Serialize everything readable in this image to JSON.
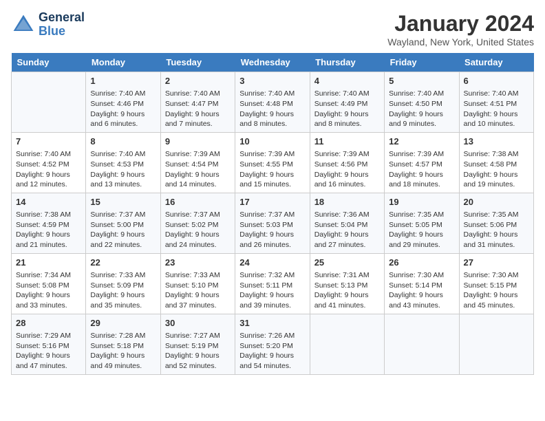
{
  "header": {
    "logo_line1": "General",
    "logo_line2": "Blue",
    "month": "January 2024",
    "location": "Wayland, New York, United States"
  },
  "days": [
    "Sunday",
    "Monday",
    "Tuesday",
    "Wednesday",
    "Thursday",
    "Friday",
    "Saturday"
  ],
  "weeks": [
    [
      {
        "date": "",
        "sunrise": "",
        "sunset": "",
        "daylight": ""
      },
      {
        "date": "1",
        "sunrise": "Sunrise: 7:40 AM",
        "sunset": "Sunset: 4:46 PM",
        "daylight": "Daylight: 9 hours and 6 minutes."
      },
      {
        "date": "2",
        "sunrise": "Sunrise: 7:40 AM",
        "sunset": "Sunset: 4:47 PM",
        "daylight": "Daylight: 9 hours and 7 minutes."
      },
      {
        "date": "3",
        "sunrise": "Sunrise: 7:40 AM",
        "sunset": "Sunset: 4:48 PM",
        "daylight": "Daylight: 9 hours and 8 minutes."
      },
      {
        "date": "4",
        "sunrise": "Sunrise: 7:40 AM",
        "sunset": "Sunset: 4:49 PM",
        "daylight": "Daylight: 9 hours and 8 minutes."
      },
      {
        "date": "5",
        "sunrise": "Sunrise: 7:40 AM",
        "sunset": "Sunset: 4:50 PM",
        "daylight": "Daylight: 9 hours and 9 minutes."
      },
      {
        "date": "6",
        "sunrise": "Sunrise: 7:40 AM",
        "sunset": "Sunset: 4:51 PM",
        "daylight": "Daylight: 9 hours and 10 minutes."
      }
    ],
    [
      {
        "date": "7",
        "sunrise": "Sunrise: 7:40 AM",
        "sunset": "Sunset: 4:52 PM",
        "daylight": "Daylight: 9 hours and 12 minutes."
      },
      {
        "date": "8",
        "sunrise": "Sunrise: 7:40 AM",
        "sunset": "Sunset: 4:53 PM",
        "daylight": "Daylight: 9 hours and 13 minutes."
      },
      {
        "date": "9",
        "sunrise": "Sunrise: 7:39 AM",
        "sunset": "Sunset: 4:54 PM",
        "daylight": "Daylight: 9 hours and 14 minutes."
      },
      {
        "date": "10",
        "sunrise": "Sunrise: 7:39 AM",
        "sunset": "Sunset: 4:55 PM",
        "daylight": "Daylight: 9 hours and 15 minutes."
      },
      {
        "date": "11",
        "sunrise": "Sunrise: 7:39 AM",
        "sunset": "Sunset: 4:56 PM",
        "daylight": "Daylight: 9 hours and 16 minutes."
      },
      {
        "date": "12",
        "sunrise": "Sunrise: 7:39 AM",
        "sunset": "Sunset: 4:57 PM",
        "daylight": "Daylight: 9 hours and 18 minutes."
      },
      {
        "date": "13",
        "sunrise": "Sunrise: 7:38 AM",
        "sunset": "Sunset: 4:58 PM",
        "daylight": "Daylight: 9 hours and 19 minutes."
      }
    ],
    [
      {
        "date": "14",
        "sunrise": "Sunrise: 7:38 AM",
        "sunset": "Sunset: 4:59 PM",
        "daylight": "Daylight: 9 hours and 21 minutes."
      },
      {
        "date": "15",
        "sunrise": "Sunrise: 7:37 AM",
        "sunset": "Sunset: 5:00 PM",
        "daylight": "Daylight: 9 hours and 22 minutes."
      },
      {
        "date": "16",
        "sunrise": "Sunrise: 7:37 AM",
        "sunset": "Sunset: 5:02 PM",
        "daylight": "Daylight: 9 hours and 24 minutes."
      },
      {
        "date": "17",
        "sunrise": "Sunrise: 7:37 AM",
        "sunset": "Sunset: 5:03 PM",
        "daylight": "Daylight: 9 hours and 26 minutes."
      },
      {
        "date": "18",
        "sunrise": "Sunrise: 7:36 AM",
        "sunset": "Sunset: 5:04 PM",
        "daylight": "Daylight: 9 hours and 27 minutes."
      },
      {
        "date": "19",
        "sunrise": "Sunrise: 7:35 AM",
        "sunset": "Sunset: 5:05 PM",
        "daylight": "Daylight: 9 hours and 29 minutes."
      },
      {
        "date": "20",
        "sunrise": "Sunrise: 7:35 AM",
        "sunset": "Sunset: 5:06 PM",
        "daylight": "Daylight: 9 hours and 31 minutes."
      }
    ],
    [
      {
        "date": "21",
        "sunrise": "Sunrise: 7:34 AM",
        "sunset": "Sunset: 5:08 PM",
        "daylight": "Daylight: 9 hours and 33 minutes."
      },
      {
        "date": "22",
        "sunrise": "Sunrise: 7:33 AM",
        "sunset": "Sunset: 5:09 PM",
        "daylight": "Daylight: 9 hours and 35 minutes."
      },
      {
        "date": "23",
        "sunrise": "Sunrise: 7:33 AM",
        "sunset": "Sunset: 5:10 PM",
        "daylight": "Daylight: 9 hours and 37 minutes."
      },
      {
        "date": "24",
        "sunrise": "Sunrise: 7:32 AM",
        "sunset": "Sunset: 5:11 PM",
        "daylight": "Daylight: 9 hours and 39 minutes."
      },
      {
        "date": "25",
        "sunrise": "Sunrise: 7:31 AM",
        "sunset": "Sunset: 5:13 PM",
        "daylight": "Daylight: 9 hours and 41 minutes."
      },
      {
        "date": "26",
        "sunrise": "Sunrise: 7:30 AM",
        "sunset": "Sunset: 5:14 PM",
        "daylight": "Daylight: 9 hours and 43 minutes."
      },
      {
        "date": "27",
        "sunrise": "Sunrise: 7:30 AM",
        "sunset": "Sunset: 5:15 PM",
        "daylight": "Daylight: 9 hours and 45 minutes."
      }
    ],
    [
      {
        "date": "28",
        "sunrise": "Sunrise: 7:29 AM",
        "sunset": "Sunset: 5:16 PM",
        "daylight": "Daylight: 9 hours and 47 minutes."
      },
      {
        "date": "29",
        "sunrise": "Sunrise: 7:28 AM",
        "sunset": "Sunset: 5:18 PM",
        "daylight": "Daylight: 9 hours and 49 minutes."
      },
      {
        "date": "30",
        "sunrise": "Sunrise: 7:27 AM",
        "sunset": "Sunset: 5:19 PM",
        "daylight": "Daylight: 9 hours and 52 minutes."
      },
      {
        "date": "31",
        "sunrise": "Sunrise: 7:26 AM",
        "sunset": "Sunset: 5:20 PM",
        "daylight": "Daylight: 9 hours and 54 minutes."
      },
      {
        "date": "",
        "sunrise": "",
        "sunset": "",
        "daylight": ""
      },
      {
        "date": "",
        "sunrise": "",
        "sunset": "",
        "daylight": ""
      },
      {
        "date": "",
        "sunrise": "",
        "sunset": "",
        "daylight": ""
      }
    ]
  ]
}
